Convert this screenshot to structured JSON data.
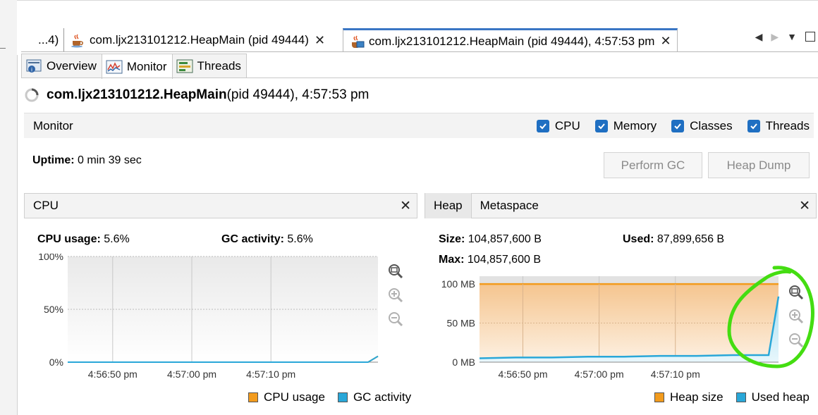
{
  "doc_tabs": {
    "truncated_label": "...4)",
    "tab1_label": "com.ljx213101212.HeapMain (pid 49444)",
    "tab2_label": "com.ljx213101212.HeapMain (pid 49444), 4:57:53 pm",
    "close_glyph": "✕"
  },
  "sub_tabs": [
    {
      "label": "Overview"
    },
    {
      "label": "Monitor"
    },
    {
      "label": "Threads"
    }
  ],
  "title": {
    "main": "com.ljx213101212.HeapMain",
    "rest": " (pid 49444), 4:57:53 pm"
  },
  "monitor_bar": {
    "label": "Monitor",
    "checks": [
      {
        "label": "CPU",
        "checked": true
      },
      {
        "label": "Memory",
        "checked": true
      },
      {
        "label": "Classes",
        "checked": true
      },
      {
        "label": "Threads",
        "checked": true
      }
    ]
  },
  "uptime": {
    "label": "Uptime:",
    "value": " 0 min 39 sec"
  },
  "buttons": {
    "perform_gc": "Perform GC",
    "heap_dump": "Heap Dump"
  },
  "cpu_panel": {
    "title": "CPU",
    "cpu_usage_label": "CPU usage:",
    "cpu_usage_value": " 5.6%",
    "gc_activity_label": "GC activity:",
    "gc_activity_value": " 5.6%",
    "legend": [
      "CPU usage",
      "GC activity"
    ]
  },
  "heap_panel": {
    "tabs": [
      "Heap",
      "Metaspace"
    ],
    "size_label": "Size:",
    "size_value": " 104,857,600 B",
    "used_label": "Used:",
    "used_value": " 87,899,656 B",
    "max_label": "Max:",
    "max_value": " 104,857,600 B",
    "legend": [
      "Heap size",
      "Used heap"
    ]
  },
  "colors": {
    "cpu_usage": "#f29b1d",
    "gc_activity": "#29a7d8",
    "heap_size": "#f29b1d",
    "used_heap": "#29a7d8",
    "annotation": "#44dd11",
    "checkbox": "#1f6fc2"
  },
  "chart_data": [
    {
      "type": "line",
      "name": "CPU",
      "x": [
        "4:56:50 pm",
        "4:57:00 pm",
        "4:57:10 pm"
      ],
      "y_ticks": [
        "100%",
        "50%",
        "0%"
      ],
      "ylim": [
        0,
        100
      ],
      "series": [
        {
          "name": "CPU usage",
          "values": [
            0,
            0,
            0,
            0,
            0,
            0,
            0,
            5.6
          ]
        },
        {
          "name": "GC activity",
          "values": [
            0,
            0,
            0,
            0,
            0,
            0,
            0,
            5.6
          ]
        }
      ],
      "legend": "bottom-right",
      "grid": true
    },
    {
      "type": "area",
      "name": "Heap",
      "x": [
        "4:56:50 pm",
        "4:57:00 pm",
        "4:57:10 pm"
      ],
      "y_ticks": [
        "100 MB",
        "50 MB",
        "0 MB"
      ],
      "ylim": [
        0,
        110
      ],
      "series": [
        {
          "name": "Heap size",
          "values": [
            100,
            100,
            100,
            100,
            100,
            100,
            100,
            100,
            100,
            100
          ]
        },
        {
          "name": "Used heap",
          "values": [
            5,
            6,
            6,
            7,
            7,
            8,
            8,
            9,
            9,
            84
          ]
        }
      ],
      "legend": "bottom-right",
      "grid": true
    }
  ]
}
